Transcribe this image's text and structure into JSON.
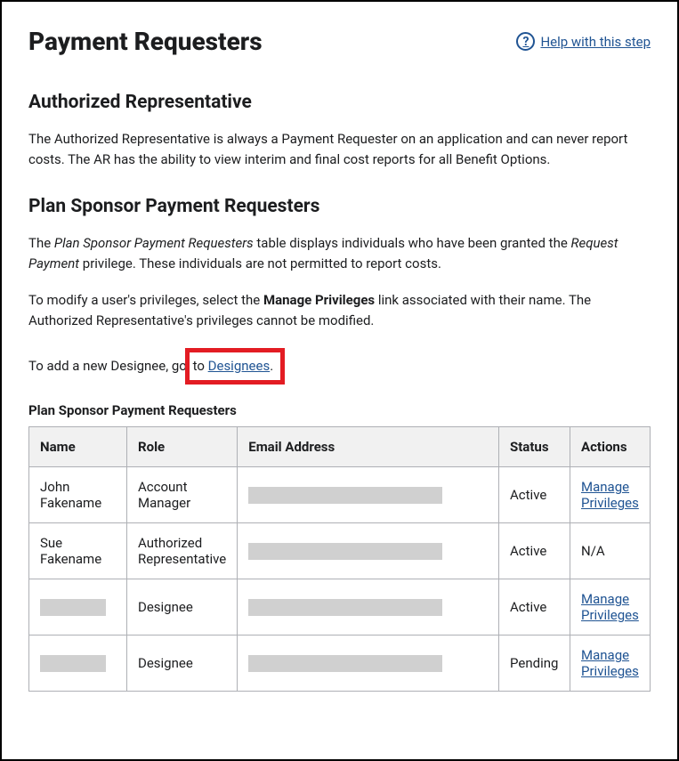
{
  "header": {
    "title": "Payment Requesters",
    "help_label": " Help with this step"
  },
  "sections": {
    "auth_rep": {
      "heading": "Authorized Representative",
      "body": "The Authorized Representative is always a Payment Requester on an application and can never report costs. The AR has the ability to view interim and final cost reports for all Benefit Options."
    },
    "plan_sponsor": {
      "heading": "Plan Sponsor Payment Requesters",
      "intro_pre": "The ",
      "intro_em": "Plan Sponsor Payment Requesters",
      "intro_mid": " table displays individuals who have been granted the ",
      "intro_em2": "Request Payment",
      "intro_post": " privilege. These individuals are not permitted to report costs.",
      "modify_pre": "To modify a user's privileges, select the ",
      "modify_strong": "Manage Privileges",
      "modify_post": " link associated with their name. The Authorized Representative's privileges cannot be modified.",
      "add_pre": "To add a new Designee, go ",
      "add_hidden": "to ",
      "add_link": "Designees",
      "add_post": "."
    }
  },
  "table": {
    "caption": "Plan Sponsor Payment Requesters",
    "headers": {
      "name": "Name",
      "role": "Role",
      "email": "Email Address",
      "status": "Status",
      "actions": "Actions"
    },
    "rows": [
      {
        "name": "John Fakename",
        "role": "Account Manager",
        "email_redacted": true,
        "status": "Active",
        "action": "Manage Privileges",
        "action_link": true
      },
      {
        "name": "Sue Fakename",
        "role": "Authorized Representative",
        "email_redacted": true,
        "status": "Active",
        "action": "N/A",
        "action_link": false
      },
      {
        "name_redacted": true,
        "role": "Designee",
        "email_redacted": true,
        "status": "Active",
        "action": "Manage Privileges",
        "action_link": true
      },
      {
        "name_redacted": true,
        "role": "Designee",
        "email_redacted": true,
        "status": "Pending",
        "action": "Manage Privileges",
        "action_link": true
      }
    ]
  }
}
